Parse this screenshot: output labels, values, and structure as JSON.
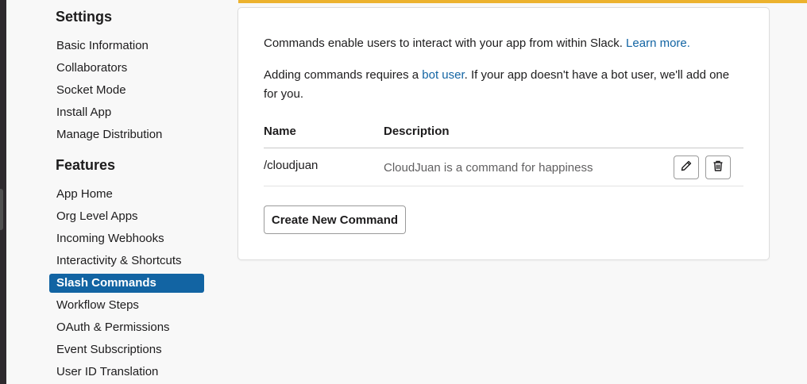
{
  "sidebar": {
    "settings_title": "Settings",
    "settings_items": [
      {
        "label": "Basic Information"
      },
      {
        "label": "Collaborators"
      },
      {
        "label": "Socket Mode"
      },
      {
        "label": "Install App"
      },
      {
        "label": "Manage Distribution"
      }
    ],
    "features_title": "Features",
    "features_items": [
      {
        "label": "App Home"
      },
      {
        "label": "Org Level Apps"
      },
      {
        "label": "Incoming Webhooks"
      },
      {
        "label": "Interactivity & Shortcuts"
      },
      {
        "label": "Slash Commands",
        "active": true
      },
      {
        "label": "Workflow Steps"
      },
      {
        "label": "OAuth & Permissions"
      },
      {
        "label": "Event Subscriptions"
      },
      {
        "label": "User ID Translation"
      }
    ]
  },
  "main": {
    "intro_text": "Commands enable users to interact with your app from within Slack.",
    "learn_more_link": "Learn more.",
    "bot_text_before": "Adding commands requires a",
    "bot_user_link": "bot user",
    "bot_text_after": ". If your app doesn't have a bot user, we'll add one for you.",
    "table": {
      "headers": {
        "name": "Name",
        "description": "Description"
      },
      "rows": [
        {
          "name": "/cloudjuan",
          "description": "CloudJuan is a command for happiness"
        }
      ]
    },
    "create_button_label": "Create New Command"
  },
  "colors": {
    "accent": "#1264a3",
    "top_bar": "#ecb22e"
  }
}
